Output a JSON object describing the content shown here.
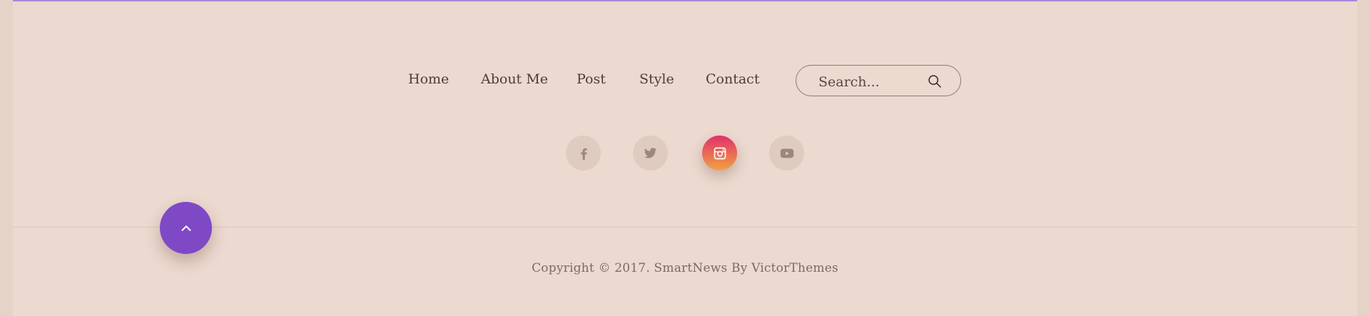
{
  "colors": {
    "page_background": "#ecd9cf",
    "outer_background": "#e6d3c8",
    "accent_purple": "#7f49c6",
    "instagram_gradient_start": "#e0306a",
    "instagram_gradient_end": "#f0a344",
    "nav_text": "#4f3d36",
    "muted_text": "#7c6a63"
  },
  "navigation": {
    "items": [
      {
        "label": "Home"
      },
      {
        "label": "About Me"
      },
      {
        "label": "Post"
      },
      {
        "label": "Style"
      },
      {
        "label": "Contact"
      }
    ]
  },
  "search": {
    "placeholder": "Search...",
    "icon": "search-icon"
  },
  "social_links": [
    {
      "icon": "facebook-icon",
      "active": false
    },
    {
      "icon": "twitter-icon",
      "active": false
    },
    {
      "icon": "instagram-icon",
      "active": true
    },
    {
      "icon": "youtube-icon",
      "active": false
    }
  ],
  "back_to_top": {
    "icon": "chevron-up-icon"
  },
  "footer": {
    "copyright": "Copyright © 2017. SmartNews By VictorThemes"
  }
}
